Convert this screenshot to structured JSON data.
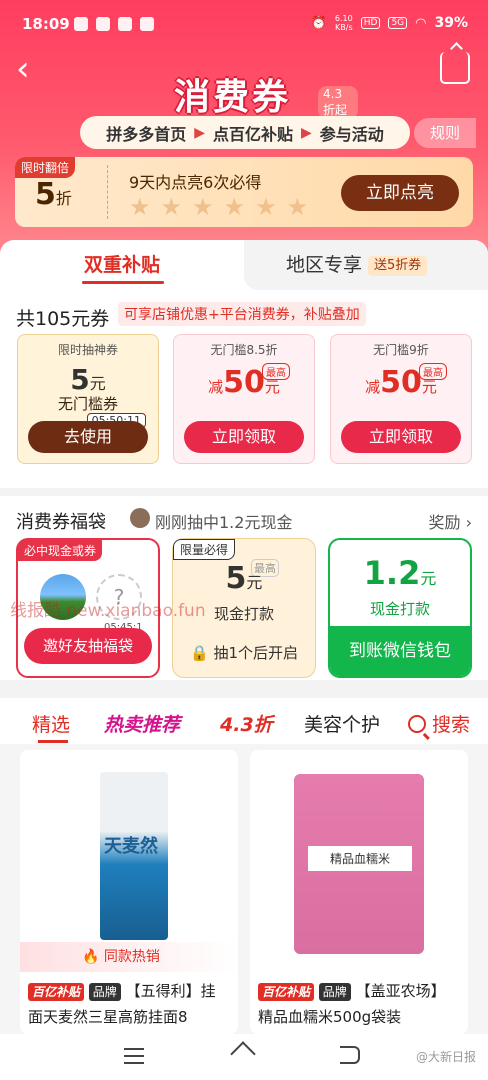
{
  "status": {
    "time": "18:09",
    "speed_value": "6.10",
    "speed_unit": "KB/s",
    "hd": "HD",
    "network": "5G",
    "battery": "39%"
  },
  "header": {
    "title": "消费券",
    "title_badge": "4.3折起",
    "steps": [
      "拼多多首页",
      "点百亿补贴",
      "参与活动"
    ],
    "rules": "规则"
  },
  "flip_banner": {
    "tag": "限时翻倍",
    "discount_num": "5",
    "discount_unit": "折",
    "desc": "9天内点亮6次必得",
    "button": "立即点亮"
  },
  "subsidy_tabs": {
    "tab1": "双重补贴",
    "tab2": "地区专享",
    "tab2_badge": "送5折券"
  },
  "coupons_summary": {
    "total": "共105元券",
    "note": "可享店铺优惠+平台消费券，补贴叠加"
  },
  "coupons": [
    {
      "head": "限时抽神券",
      "amount": "5",
      "unit": "元",
      "desc": "无门槛券",
      "timer": "05:50:11",
      "button": "去使用"
    },
    {
      "head": "无门槛8.5折",
      "prefix": "减",
      "amount": "50",
      "unit": "元",
      "max": "最高",
      "button": "立即领取"
    },
    {
      "head": "无门槛9折",
      "prefix": "减",
      "amount": "50",
      "unit": "元",
      "max": "最高",
      "button": "立即领取"
    }
  ],
  "lucky_bag": {
    "title": "消费券福袋",
    "winner": "刚刚抽中1.2元现金",
    "reward": "奖励",
    "card1": {
      "flag": "必中现金或券",
      "mini": "05:45:1",
      "button": "邀好友抽福袋"
    },
    "card2": {
      "flag": "限量必得",
      "max": "最高",
      "amount": "5",
      "unit": "元",
      "sub": "现金打款",
      "lock": "抽1个后开启"
    },
    "card3": {
      "amount": "1.2",
      "unit": "元",
      "sub": "现金打款",
      "button": "到账微信钱包"
    }
  },
  "watermark": "线报酷 new.xianbao.fun",
  "feed_tabs": [
    "精选",
    "热卖推荐",
    "4.3折",
    "美容个护"
  ],
  "search_label": "搜索",
  "products": [
    {
      "pack_text": "天麦然",
      "hot": "同款热销",
      "badge1": "百亿补贴",
      "badge2": "品牌",
      "name": "【五得利】挂面天麦然三星高筋挂面8"
    },
    {
      "pack_text": "精品血糯米",
      "badge1": "百亿补贴",
      "badge2": "品牌",
      "name": "【盖亚农场】精品血糯米500g袋装"
    }
  ],
  "weibo_mark": "@大新日报"
}
